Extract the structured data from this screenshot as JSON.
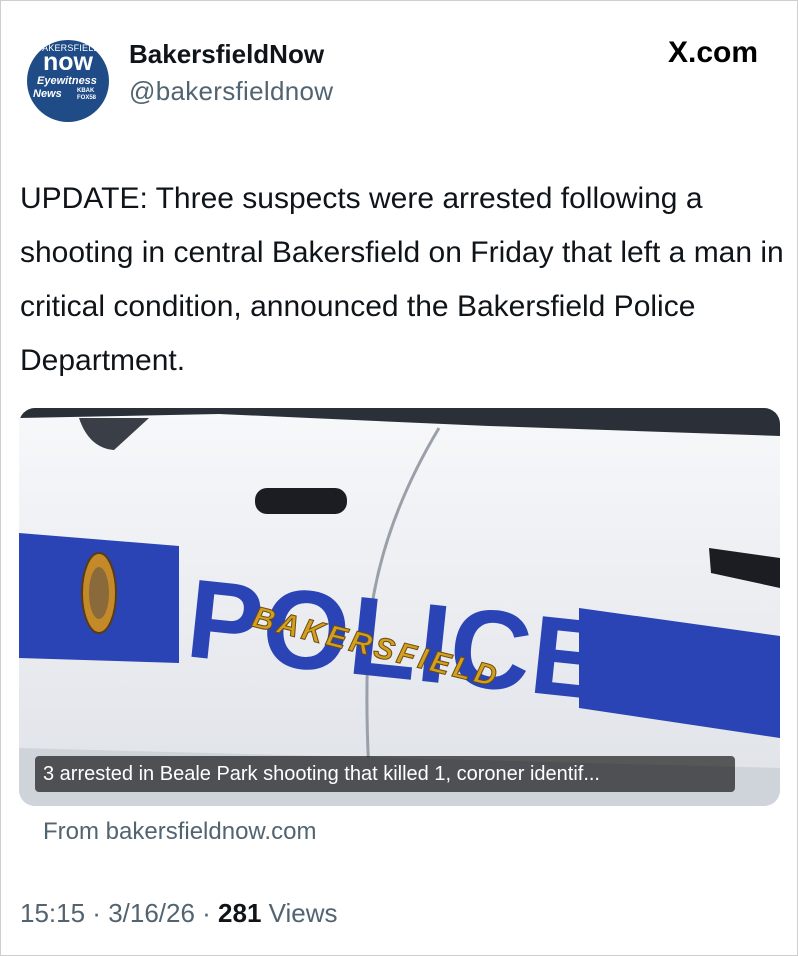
{
  "account": {
    "avatar": {
      "line1": "BAKERSFIELD",
      "line2": "now",
      "line3": "Eyewitness",
      "line4": "News",
      "line5a": "KBAK",
      "line5b": "FOX58"
    },
    "name": "BakersfieldNow",
    "handle": "@bakersfieldnow"
  },
  "brand": "X.com",
  "tweet": {
    "text": "UPDATE: Three suspects were arrested following a shooting in central Bakersfield on Friday that left a man in critical condition, announced the Bakersfield Police Department."
  },
  "media": {
    "image_icon": "police-car-photo",
    "car_word": "POLICE",
    "car_city": "BAKERSFIELD",
    "caption": "3 arrested in Beale Park shooting that killed 1, coroner identif...",
    "source": "From bakersfieldnow.com"
  },
  "meta": {
    "time": "15:15",
    "sep1": " · ",
    "date": "3/16/26",
    "sep2": " · ",
    "views_count": "281",
    "views_label": " Views"
  },
  "colors": {
    "police_blue": "#2a44b5",
    "police_gold": "#d2a01e",
    "text_primary": "#0f1419",
    "text_secondary": "#536471",
    "avatar_bg": "#1f4b86"
  }
}
